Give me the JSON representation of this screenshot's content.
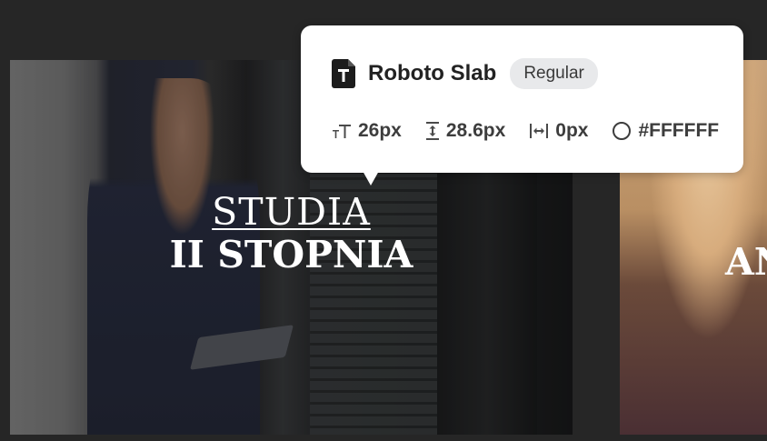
{
  "tooltip": {
    "font_family": "Roboto Slab",
    "font_style": "Regular",
    "font_size": "26px",
    "line_height": "28.6px",
    "letter_spacing": "0px",
    "color_value": "#FFFFFF",
    "icons": {
      "file": "font-file-icon",
      "size": "font-size-icon",
      "line_height": "line-height-icon",
      "letter_spacing": "letter-spacing-icon",
      "color": "color-swatch-icon"
    }
  },
  "cards": [
    {
      "title_line1": "STUDIA",
      "title_line2": "II STOPNIA"
    },
    {
      "title_partial": "AN"
    }
  ],
  "colors": {
    "page_bg": "#262626",
    "tooltip_bg": "#ffffff",
    "pill_bg": "#e8e9eb",
    "card_text": "#FFFFFF"
  }
}
